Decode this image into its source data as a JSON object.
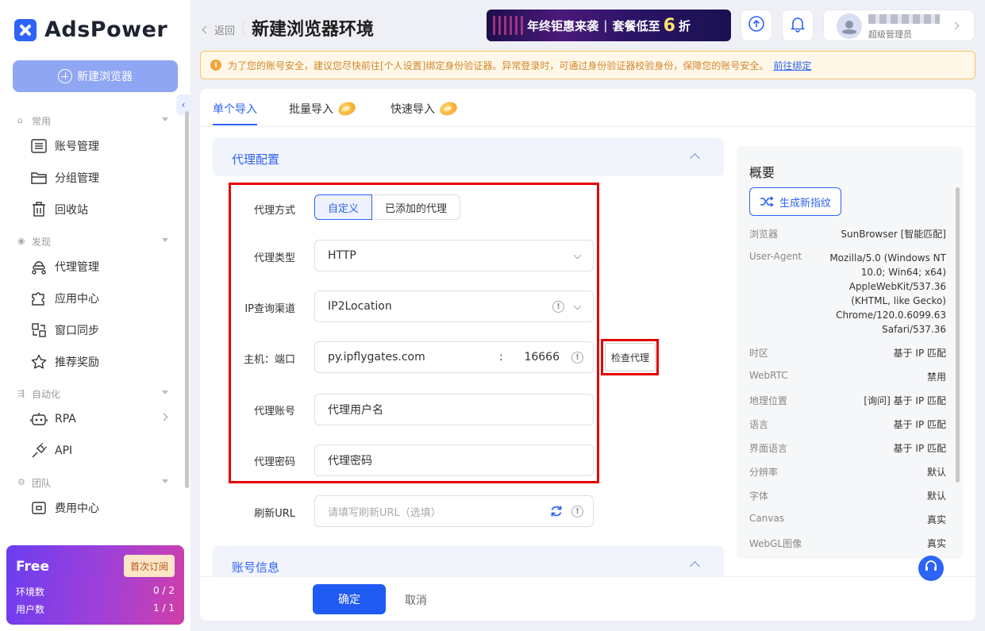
{
  "sidebar": {
    "brand": "AdsPower",
    "new_browser": "新建浏览器",
    "groups": [
      {
        "label": "常用",
        "items": [
          {
            "label": "账号管理"
          },
          {
            "label": "分组管理"
          },
          {
            "label": "回收站"
          }
        ]
      },
      {
        "label": "发现",
        "items": [
          {
            "label": "代理管理"
          },
          {
            "label": "应用中心"
          },
          {
            "label": "窗口同步"
          },
          {
            "label": "推荐奖励"
          }
        ]
      },
      {
        "label": "自动化",
        "items": [
          {
            "label": "RPA"
          },
          {
            "label": "API"
          }
        ]
      },
      {
        "label": "团队",
        "items": [
          {
            "label": "费用中心"
          }
        ]
      }
    ],
    "plan": {
      "name": "Free",
      "subscribe": "首次订阅",
      "env_label": "环境数",
      "env_value": "0 / 2",
      "user_label": "用户数",
      "user_value": "1 / 1"
    }
  },
  "header": {
    "back": "返回",
    "title": "新建浏览器环境",
    "promo": {
      "part1": "年终钜惠来袭",
      "part2": "套餐低至",
      "number": "6",
      "unit": "折"
    },
    "user_role": "超级管理员"
  },
  "alert": {
    "text": "为了您的账号安全，建议您尽快前往[个人设置]绑定身份验证器。异常登录时，可通过身份验证器校验身份，保障您的账号安全。",
    "link": "前往绑定"
  },
  "tabs": [
    {
      "label": "单个导入"
    },
    {
      "label": "批量导入"
    },
    {
      "label": "快速导入"
    }
  ],
  "proxy": {
    "section_title": "代理配置",
    "method_label": "代理方式",
    "method_options": [
      "自定义",
      "已添加的代理"
    ],
    "type_label": "代理类型",
    "type_value": "HTTP",
    "channel_label": "IP查询渠道",
    "channel_value": "IP2Location",
    "host_label": "主机：端口",
    "host_value": "py.ipflygates.com",
    "colon": ":",
    "port_value": "16666",
    "check_button": "检查代理",
    "user_label": "代理账号",
    "user_placeholder": "代理用户名",
    "pass_label": "代理密码",
    "pass_placeholder": "代理密码",
    "refresh_label": "刷新URL",
    "refresh_placeholder": "请填写刷新URL（选填）"
  },
  "account_section_title": "账号信息",
  "footer": {
    "ok": "确定",
    "cancel": "取消"
  },
  "overview": {
    "title": "概要",
    "generate": "生成新指纹",
    "rows": [
      {
        "key": "浏览器",
        "value": "SunBrowser [智能匹配]"
      },
      {
        "key": "User-Agent",
        "value": "Mozilla/5.0 (Windows NT 10.0; Win64; x64) AppleWebKit/537.36 (KHTML, like Gecko) Chrome/120.0.6099.63 Safari/537.36"
      },
      {
        "key": "时区",
        "value": "基于 IP 匹配"
      },
      {
        "key": "WebRTC",
        "value": "禁用"
      },
      {
        "key": "地理位置",
        "value": "[询问] 基于 IP 匹配"
      },
      {
        "key": "语言",
        "value": "基于 IP 匹配"
      },
      {
        "key": "界面语言",
        "value": "基于 IP 匹配"
      },
      {
        "key": "分辨率",
        "value": "默认"
      },
      {
        "key": "字体",
        "value": "默认"
      },
      {
        "key": "Canvas",
        "value": "真实"
      },
      {
        "key": "WebGL图像",
        "value": "真实"
      }
    ]
  },
  "colors": {
    "primary": "#2d63f6",
    "highlight": "#e30000",
    "warning": "#f3a53a"
  }
}
